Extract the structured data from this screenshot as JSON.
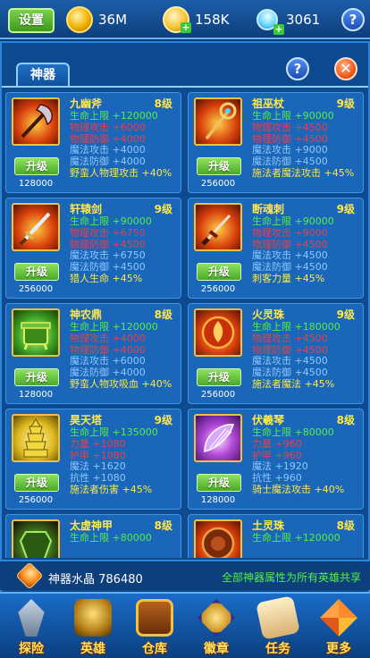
{
  "topbar": {
    "settings_label": "设置",
    "gold": "36M",
    "coins": "158K",
    "gems": "3061",
    "help": "?"
  },
  "panel": {
    "tab_label": "神器",
    "help": "?",
    "close": "✕"
  },
  "upgrade_label": "升级",
  "artifacts": [
    {
      "name": "九幽斧",
      "level": "8级",
      "cost": "128000",
      "stats": [
        "生命上限 +120000",
        "物理攻击 +6000",
        "物理防御 +4000",
        "魔法攻击 +4000",
        "魔法防御 +4000",
        "野蛮人物理攻击 +40%"
      ]
    },
    {
      "name": "祖巫杖",
      "level": "9级",
      "cost": "256000",
      "stats": [
        "生命上限 +90000",
        "物理攻击 +4500",
        "物理防御 +4500",
        "魔法攻击 +9000",
        "魔法防御 +4500",
        "施法者魔法攻击 +45%"
      ]
    },
    {
      "name": "轩辕剑",
      "level": "9级",
      "cost": "256000",
      "stats": [
        "生命上限 +90000",
        "物理攻击 +6750",
        "物理防御 +4500",
        "魔法攻击 +6750",
        "魔法防御 +4500",
        "猎人生命 +45%"
      ]
    },
    {
      "name": "断魂刺",
      "level": "9级",
      "cost": "256000",
      "stats": [
        "生命上限 +90000",
        "物理攻击 +9000",
        "物理防御 +4500",
        "魔法攻击 +4500",
        "魔法防御 +4500",
        "刺客力量 +45%"
      ]
    },
    {
      "name": "神农鼎",
      "level": "8级",
      "cost": "128000",
      "stats": [
        "生命上限 +120000",
        "物理攻击 +4000",
        "物理防御 +4000",
        "魔法攻击 +6000",
        "魔法防御 +4000",
        "野蛮人物攻吸血 +40%"
      ]
    },
    {
      "name": "火灵珠",
      "level": "9级",
      "cost": "256000",
      "stats": [
        "生命上限 +180000",
        "物理攻击 +4500",
        "物理防御 +4500",
        "魔法攻击 +4500",
        "魔法防御 +4500",
        "施法者魔法 +45%"
      ]
    },
    {
      "name": "昊天塔",
      "level": "9级",
      "cost": "256000",
      "stats": [
        "生命上限 +135000",
        "力量 +1080",
        "护甲 +1080",
        "魔法 +1620",
        "抗性 +1080",
        "施法者伤害 +45%"
      ]
    },
    {
      "name": "伏羲琴",
      "level": "8级",
      "cost": "128000",
      "stats": [
        "生命上限 +80000",
        "力量 +960",
        "护甲 +960",
        "魔法 +1920",
        "抗性 +960",
        "骑士魔法攻击 +40%"
      ]
    },
    {
      "name": "太虚神甲",
      "level": "8级",
      "cost": "",
      "stats": [
        "生命上限 +80000"
      ]
    },
    {
      "name": "土灵珠",
      "level": "8级",
      "cost": "",
      "stats": [
        "生命上限 +120000"
      ]
    }
  ],
  "crystal": {
    "label": "神器水晶 786480",
    "note": "全部神器属性为所有英雄共享"
  },
  "nav": [
    {
      "label": "探险",
      "icon": "sword-helmet-icon"
    },
    {
      "label": "英雄",
      "icon": "hero-helmet-icon"
    },
    {
      "label": "仓库",
      "icon": "treasure-chest-icon"
    },
    {
      "label": "徽章",
      "icon": "emblem-icon"
    },
    {
      "label": "任务",
      "icon": "scroll-icon"
    },
    {
      "label": "更多",
      "icon": "more-icon"
    }
  ]
}
